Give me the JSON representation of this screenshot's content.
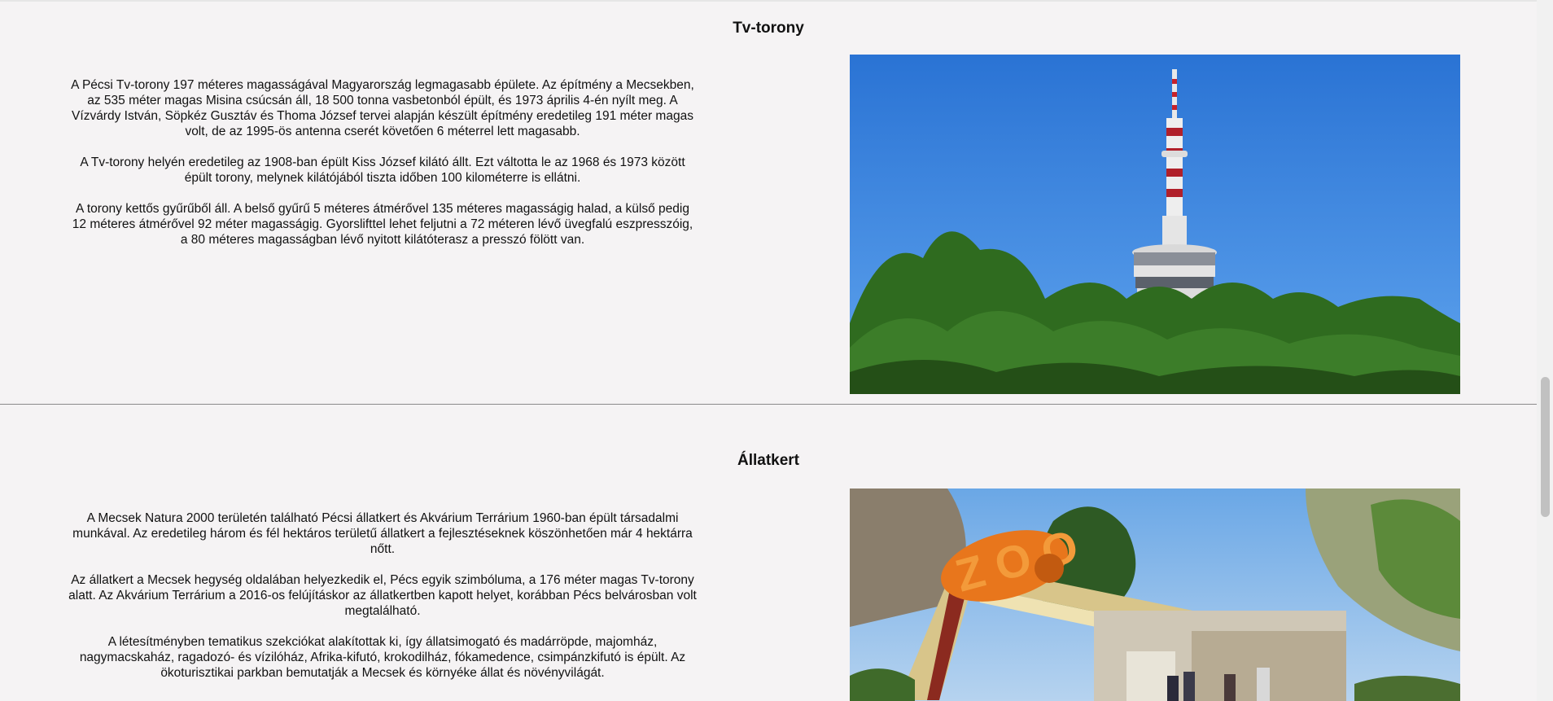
{
  "sections": [
    {
      "title": "Tv-torony",
      "paragraphs": [
        "A Pécsi Tv-torony 197 méteres magasságával Magyarország legmagasabb épülete. Az építmény a Mecsekben, az 535 méter magas Misina csúcsán áll, 18 500 tonna vasbetonból épült, és 1973 április 4-én nyílt meg. A Vízvárdy István, Söpkéz Gusztáv és Thoma József tervei alapján készült építmény eredetileg 191 méter magas volt, de az 1995-ös antenna cserét követően 6 méterrel lett magasabb.",
        "A Tv-torony helyén eredetileg az 1908-ban épült Kiss József kilátó állt. Ezt váltotta le az 1968 és 1973 között épült torony, melynek kilátójából tiszta időben 100 kilométerre is ellátni.",
        "A torony kettős gyűrűből áll. A belső gyűrű 5 méteres átmérővel 135 méteres magasságig halad, a külső pedig 12 méteres átmérővel 92 méter magasságig. Gyorslifttel lehet feljutni a 72 méteren lévő üvegfalú eszpresszóig, a 80 méteres magasságban lévő nyitott kilátóterasz a presszó fölött van."
      ]
    },
    {
      "title": "Állatkert",
      "paragraphs": [
        "A Mecsek Natura 2000 területén található Pécsi állatkert és Akvárium Terrárium 1960-ban épült társadalmi munkával. Az eredetileg három és fél hektáros területű állatkert a fejlesztéseknek köszönhetően már 4 hektárra nőtt.",
        "Az állatkert a Mecsek hegység oldalában helyezkedik el, Pécs egyik szimbóluma, a 176 méter magas Tv-torony alatt. Az Akvárium Terrárium a 2016-os felújításkor az állatkertben kapott helyet, korábban Pécs belvárosban volt megtalálható.",
        "A létesítményben tematikus szekciókat alakítottak ki, így állatsimogató és madárröpde, majomház, nagymacskaház, ragadozó- és vízilóház, Afrika-kifutó, krokodilház, fókamedence, csimpánzkifutó is épült. Az ökoturisztikai parkban bemutatják a Mecsek és környéke állat és növényvilágát."
      ]
    }
  ],
  "images": {
    "tower_sign": "Z O O"
  },
  "colors": {
    "page_background": "#f5f3f4",
    "divider": "#8a8a8a",
    "sky_blue": "#2f7fd8",
    "foliage_green": "#2f6b1f",
    "zoo_orange": "#e8761c"
  }
}
